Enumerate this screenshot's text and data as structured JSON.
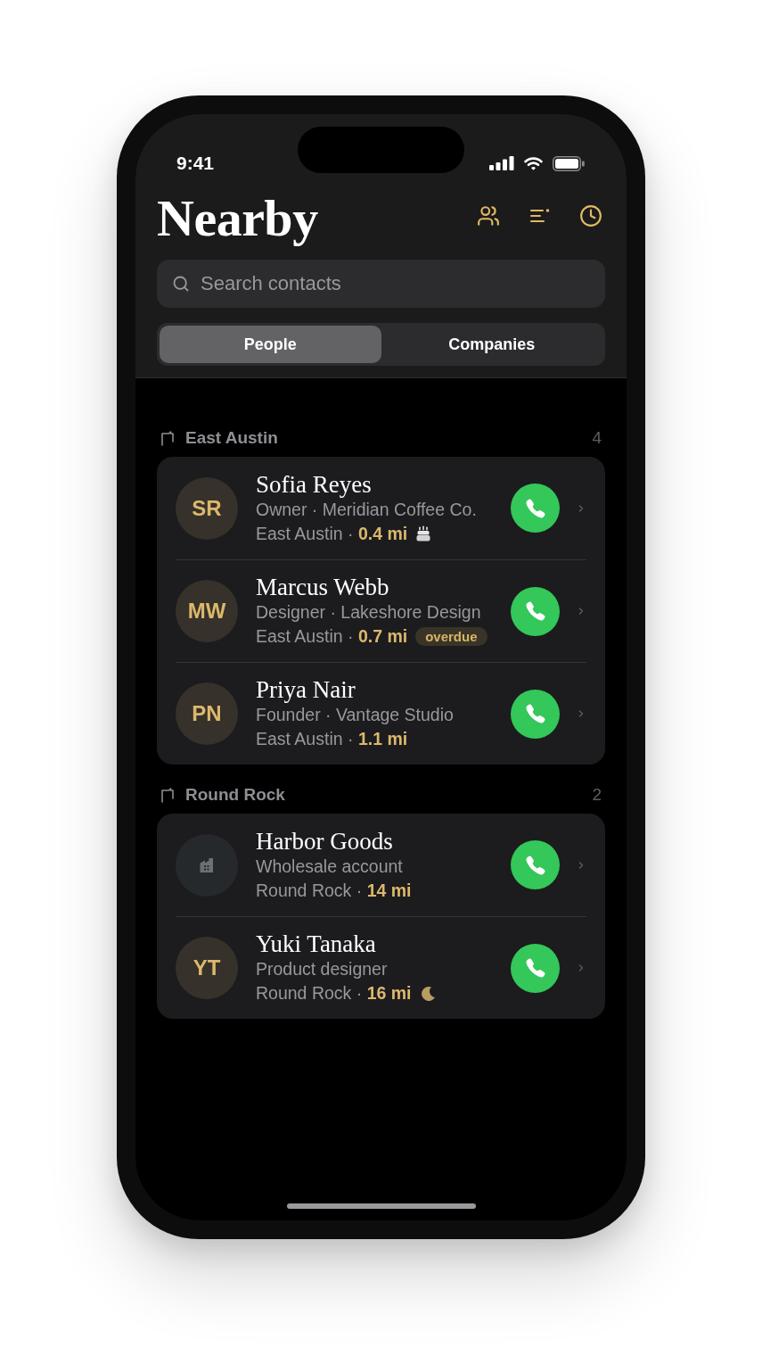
{
  "status_bar": {
    "time": "9:41"
  },
  "header": {
    "title": "Nearby"
  },
  "search": {
    "placeholder": "Search contacts"
  },
  "tabs": [
    {
      "label": "People",
      "selected": true
    },
    {
      "label": "Companies",
      "selected": false
    }
  ],
  "sections": [
    {
      "title": "East Austin",
      "count": "4",
      "contacts": [
        {
          "avatar": {
            "kind": "initials",
            "text": "SR"
          },
          "name": "Sofia Reyes",
          "subtitle": "Owner · Meridian Coffee Co.",
          "detail": "East Austin · **0.4 mi**",
          "extra": {
            "kind": "birthday"
          }
        },
        {
          "avatar": {
            "kind": "initials",
            "text": "MW"
          },
          "name": "Marcus Webb",
          "subtitle": "Designer · Lakeshore Design",
          "detail": "East Austin · **0.7 mi**",
          "extra": {
            "kind": "badge",
            "text": "overdue"
          }
        },
        {
          "avatar": {
            "kind": "initials",
            "text": "PN"
          },
          "name": "Priya Nair",
          "subtitle": "Founder · Vantage Studio",
          "detail": "East Austin · **1.1 mi**"
        }
      ]
    },
    {
      "title": "Round Rock",
      "count": "2",
      "contacts": [
        {
          "avatar": {
            "kind": "company"
          },
          "name": "Harbor Goods",
          "subtitle": "Wholesale account",
          "detail": "Round Rock · **14 mi**"
        },
        {
          "avatar": {
            "kind": "initials",
            "text": "YT"
          },
          "name": "Yuki Tanaka",
          "subtitle": "Product designer",
          "detail": "Round Rock · **16 mi**",
          "extra": {
            "kind": "night"
          }
        }
      ]
    }
  ]
}
